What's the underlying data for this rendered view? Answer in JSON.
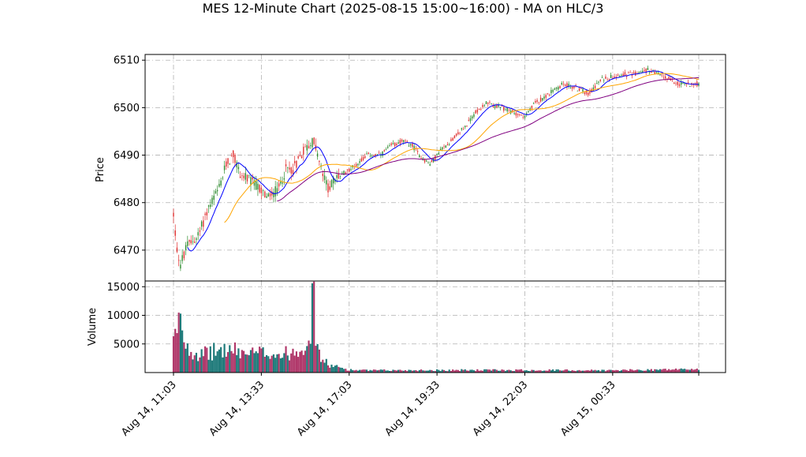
{
  "chart_data": {
    "type": "candlestick",
    "title": "MES 12-Minute Chart (2025-08-15 15:00~16:00) - MA on HLC/3",
    "price_panel": {
      "ylabel": "Price",
      "ylim": [
        6463.5,
        6511.2
      ],
      "yticks": [
        6470,
        6480,
        6490,
        6500,
        6510
      ],
      "ytick_labels": [
        "6470",
        "6480",
        "6490",
        "6500",
        "6510"
      ],
      "grid": true
    },
    "volume_panel": {
      "ylabel": "Volume",
      "ylim": [
        0,
        16000
      ],
      "yticks": [
        5000,
        10000,
        15000
      ],
      "ytick_labels": [
        "5000",
        "10000",
        "15000"
      ],
      "grid": true
    },
    "x_tick_labels": [
      "Aug 14, 11:03",
      "Aug 14, 13:33",
      "Aug 14, 17:03",
      "Aug 14, 19:33",
      "Aug 14, 22:03",
      "Aug 15, 00:33"
    ],
    "price_anchors": [
      [
        0,
        6477.5
      ],
      [
        2,
        6470
      ],
      [
        4,
        6467
      ],
      [
        8,
        6471
      ],
      [
        14,
        6473
      ],
      [
        20,
        6479
      ],
      [
        26,
        6483
      ],
      [
        30,
        6488
      ],
      [
        34,
        6490
      ],
      [
        38,
        6486
      ],
      [
        46,
        6484
      ],
      [
        54,
        6481
      ],
      [
        60,
        6483
      ],
      [
        64,
        6487
      ],
      [
        68,
        6487
      ],
      [
        74,
        6491
      ],
      [
        80,
        6493
      ],
      [
        84,
        6487
      ],
      [
        88,
        6483
      ],
      [
        92,
        6485
      ],
      [
        96,
        6486
      ],
      [
        104,
        6488
      ],
      [
        110,
        6490
      ],
      [
        118,
        6490
      ],
      [
        124,
        6492
      ],
      [
        130,
        6493
      ],
      [
        136,
        6492
      ],
      [
        140,
        6490
      ],
      [
        146,
        6488
      ],
      [
        152,
        6491
      ],
      [
        158,
        6493
      ],
      [
        166,
        6496
      ],
      [
        172,
        6499
      ],
      [
        178,
        6501
      ],
      [
        186,
        6500
      ],
      [
        194,
        6499
      ],
      [
        200,
        6498
      ],
      [
        206,
        6501
      ],
      [
        214,
        6503
      ],
      [
        222,
        6505
      ],
      [
        230,
        6504
      ],
      [
        236,
        6503
      ],
      [
        244,
        6506
      ],
      [
        254,
        6507
      ],
      [
        262,
        6507
      ],
      [
        270,
        6508
      ],
      [
        276,
        6507
      ],
      [
        282,
        6506
      ],
      [
        288,
        6505
      ],
      [
        299,
        6505
      ]
    ],
    "volume_anchors": [
      [
        0,
        5800
      ],
      [
        2,
        6800
      ],
      [
        4,
        10300
      ],
      [
        6,
        6200
      ],
      [
        10,
        4200
      ],
      [
        16,
        3200
      ],
      [
        22,
        3800
      ],
      [
        30,
        4200
      ],
      [
        38,
        3800
      ],
      [
        46,
        3400
      ],
      [
        54,
        3800
      ],
      [
        62,
        3200
      ],
      [
        70,
        4200
      ],
      [
        74,
        5200
      ],
      [
        76,
        6400
      ],
      [
        78,
        8200
      ],
      [
        79,
        12000
      ],
      [
        80,
        15900
      ],
      [
        81,
        7500
      ],
      [
        83,
        3200
      ],
      [
        86,
        2000
      ],
      [
        90,
        1200
      ],
      [
        95,
        900
      ],
      [
        100,
        500
      ],
      [
        110,
        400
      ],
      [
        150,
        450
      ],
      [
        200,
        450
      ],
      [
        250,
        400
      ],
      [
        299,
        650
      ]
    ],
    "moving_averages": [
      {
        "color": "#0000ff",
        "period": 9
      },
      {
        "color": "#ffa500",
        "period": 30
      },
      {
        "color": "#800080",
        "period": 60
      }
    ],
    "up_color": "#2e8b2e",
    "down_color": "#e03030",
    "volume_up_color": "#1f7a7a",
    "volume_down_color": "#b0386a"
  }
}
